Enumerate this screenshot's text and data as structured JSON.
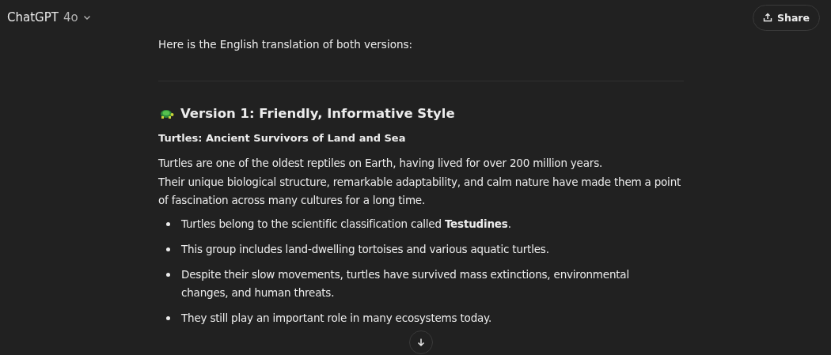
{
  "header": {
    "model_name": "ChatGPT",
    "model_version": "4o",
    "share_label": "Share"
  },
  "message": {
    "intro": "Here is the English translation of both versions:",
    "heading": "Version 1: Friendly, Informative Style",
    "subtitle": "Turtles: Ancient Survivors of Land and Sea",
    "paragraph_lines": [
      "Turtles are one of the oldest reptiles on Earth, having lived for over 200 million years.",
      "Their unique biological structure, remarkable adaptability, and calm nature have made them a point of fascination across many cultures for a long time."
    ],
    "bullets": [
      "Turtles belong to the scientific classification called **Testudines**.",
      "This group includes land-dwelling tortoises and various aquatic turtles.",
      "Despite their slow movements, turtles have survived mass extinctions, environmental changes, and human threats.",
      "They still play an important role in many ecosystems today."
    ]
  }
}
